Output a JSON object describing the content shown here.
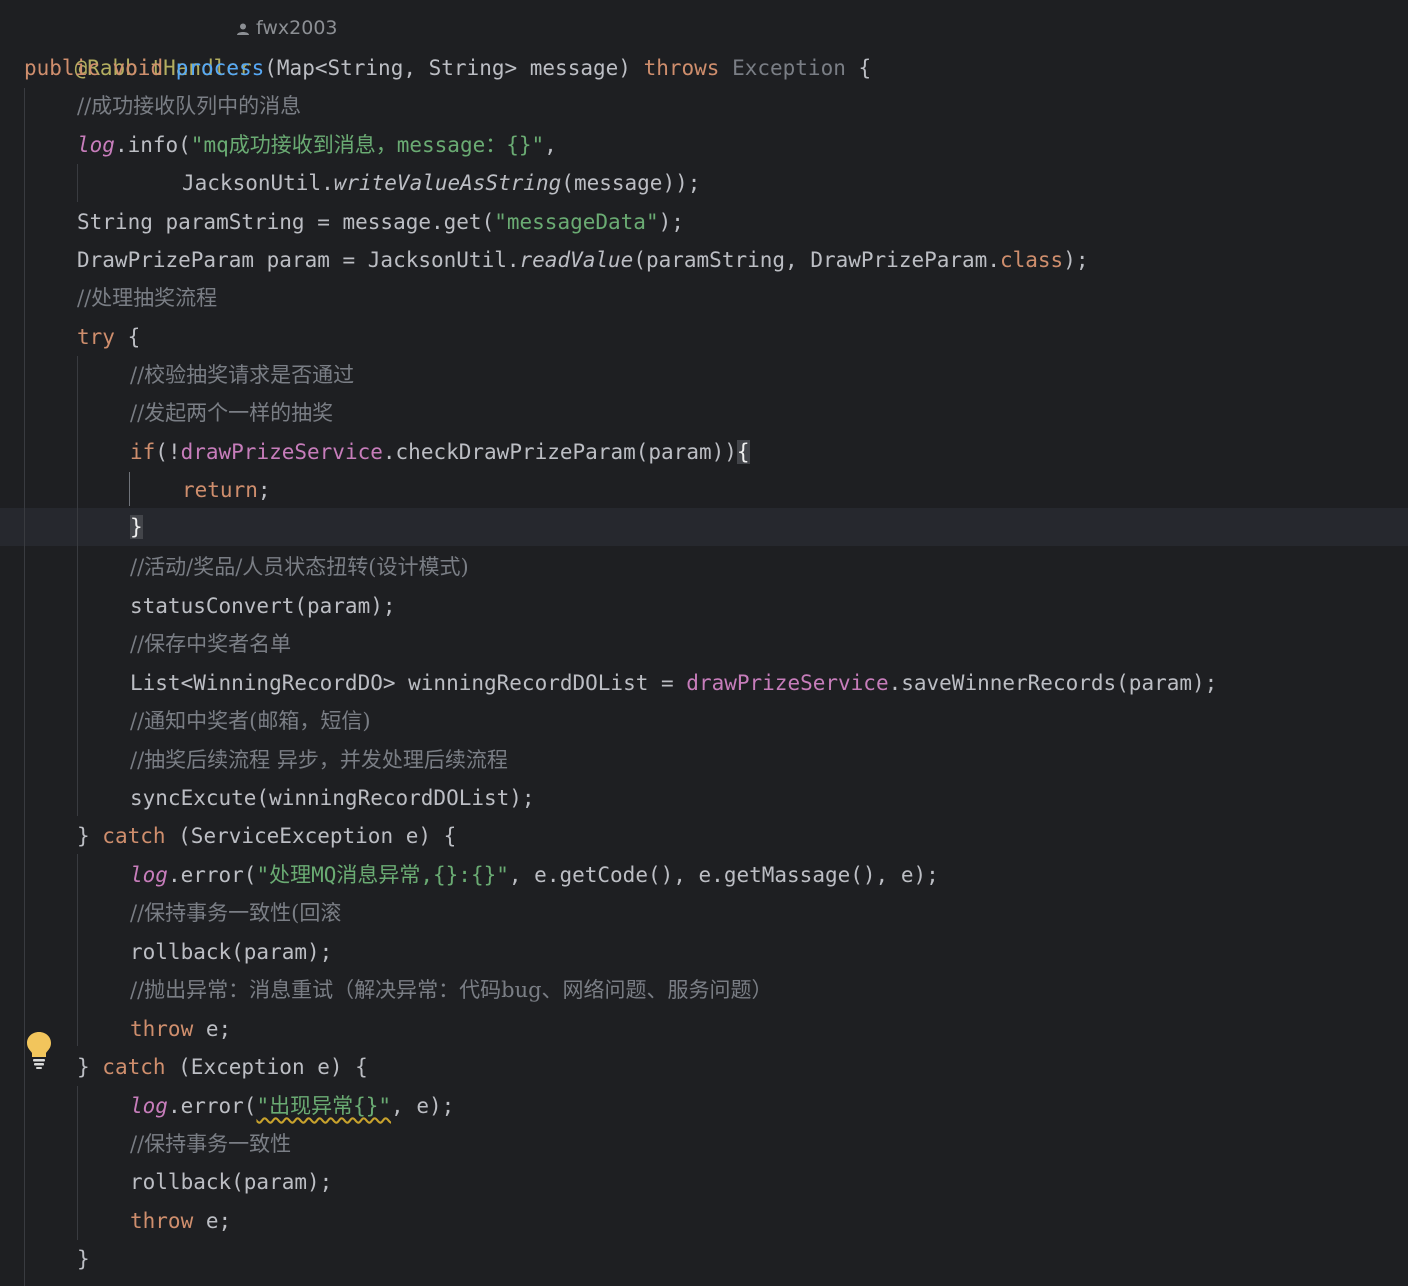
{
  "editor": {
    "annotation": "@RabbitHandler",
    "author": "fwx2003",
    "sig": {
      "public": "public",
      "void": "void",
      "name": "process",
      "params": "(Map<String, String> message) ",
      "throws": "throws",
      "exception": "Exception",
      "open": " {"
    },
    "c1": "//成功接收队列中的消息",
    "log_info": {
      "log": "log",
      "call": ".info(",
      "str": "\"mq成功接收到消息，message：{}\"",
      "tail": ","
    },
    "jackson_write": {
      "cls": "JacksonUtil.",
      "method": "writeValueAsString",
      "tail": "(message));"
    },
    "param_string": {
      "head": "String paramString = message.get(",
      "str": "\"messageData\"",
      "tail": ");"
    },
    "draw_param": {
      "head": "DrawPrizeParam param = JacksonUtil.",
      "method": "readValue",
      "mid": "(paramString, DrawPrizeParam.",
      "kw": "class",
      "tail": ");"
    },
    "c2": "//处理抽奖流程",
    "try_kw": "try",
    "try_open": " {",
    "c3": "//校验抽奖请求是否通过",
    "c4": "//发起两个一样的抽奖",
    "if_line": {
      "kw": "if",
      "pre": "(!",
      "field": "drawPrizeService",
      "call": ".checkDrawPrizeParam(param))",
      "brace": "{"
    },
    "return_kw": "return",
    "return_tail": ";",
    "close_brace": "}",
    "c5": "//活动/奖品/人员状态扭转(设计模式)",
    "status_convert": "statusConvert(param);",
    "c6": "//保存中奖者名单",
    "winning": {
      "head": "List<WinningRecordDO> winningRecordDOList = ",
      "field": "drawPrizeService",
      "tail": ".saveWinnerRecords(param);"
    },
    "c7": "//通知中奖者(邮箱，短信)",
    "c8": "//抽奖后续流程 异步，并发处理后续流程",
    "sync": "syncExcute(winningRecordDOList);",
    "catch1": {
      "close": "} ",
      "kw": "catch",
      "tail": " (ServiceException e) {"
    },
    "log_err1": {
      "log": "log",
      "call": ".error(",
      "str": "\"处理MQ消息异常,{}:{}\"",
      "tail": ", e.getCode(), e.getMassage(), e);"
    },
    "c9": "//保持事务一致性(回滚",
    "rollback": "rollback(param);",
    "c10": "//抛出异常：消息重试（解决异常：代码bug、网络问题、服务问题）",
    "throw_kw": "throw",
    "throw_tail": " e;",
    "catch2": {
      "close": "} ",
      "kw": "catch",
      "tail": " (Exception e) {"
    },
    "log_err2": {
      "log": "log",
      "call": ".error(",
      "str": "\"出现异常{}\"",
      "tail": ", e);"
    },
    "c11": "//保持事务一致性",
    "final_brace": "}"
  },
  "colors": {
    "background": "#1e1f22",
    "keyword": "#cf8e6d",
    "function": "#56a8f5",
    "string": "#6aab73",
    "comment": "#7a7e85",
    "annotation": "#b3ae60",
    "field": "#c77dbb",
    "text": "#bcbec4"
  },
  "icons": {
    "author": "user-icon",
    "intention": "lightbulb-icon"
  }
}
